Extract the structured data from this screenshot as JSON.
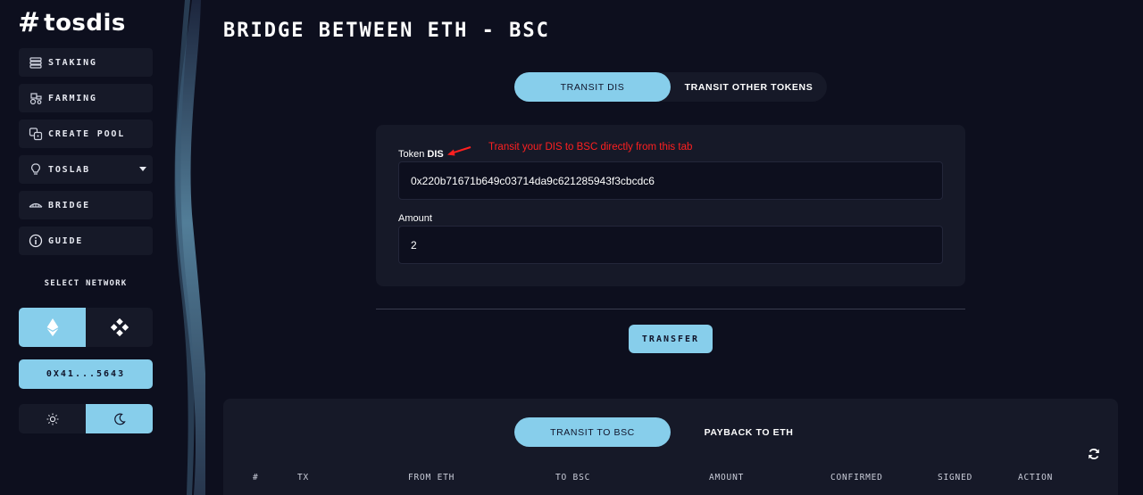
{
  "brand": {
    "logo_mark": "#",
    "logo_text": "tosdis"
  },
  "sidebar": {
    "items": [
      {
        "label": "STAKING",
        "icon": "coins-icon"
      },
      {
        "label": "FARMING",
        "icon": "tractor-icon"
      },
      {
        "label": "CREATE POOL",
        "icon": "dice-icon"
      },
      {
        "label": "TOSLAB",
        "icon": "lightbulb-icon"
      },
      {
        "label": "BRIDGE",
        "icon": "bridge-icon"
      },
      {
        "label": "GUIDE",
        "icon": "info-icon"
      }
    ],
    "select_network_label": "SELECT NETWORK",
    "networks": [
      {
        "name": "ethereum",
        "icon": "ethereum-icon",
        "active": true
      },
      {
        "name": "bsc",
        "icon": "binance-icon",
        "active": false
      }
    ],
    "wallet_address": "0X41...5643",
    "theme": {
      "light_icon": "sun-icon",
      "dark_icon": "moon-icon",
      "active": "dark"
    }
  },
  "page": {
    "title": "BRIDGE BETWEEN ETH - BSC"
  },
  "top_tabs": {
    "active": "TRANSIT DIS",
    "other": "TRANSIT OTHER TOKENS"
  },
  "form": {
    "token_label_prefix": "Token ",
    "token_label_symbol": "DIS",
    "annotation": "Transit your DIS to BSC directly from this tab",
    "token_address": "0x220b71671b649c03714da9c621285943f3cbcdc6",
    "amount_label": "Amount",
    "amount_value": "2",
    "transfer_label": "TRANSFER"
  },
  "history": {
    "tabs": {
      "active": "TRANSIT TO BSC",
      "other": "PAYBACK TO ETH"
    },
    "columns": [
      "#",
      "TX",
      "FROM ETH",
      "TO BSC",
      "AMOUNT",
      "CONFIRMED",
      "SIGNED",
      "ACTION"
    ]
  },
  "colors": {
    "background": "#0d0f1e",
    "panel": "#161928",
    "accent": "#87ceeb",
    "annotation": "#ff2020"
  }
}
